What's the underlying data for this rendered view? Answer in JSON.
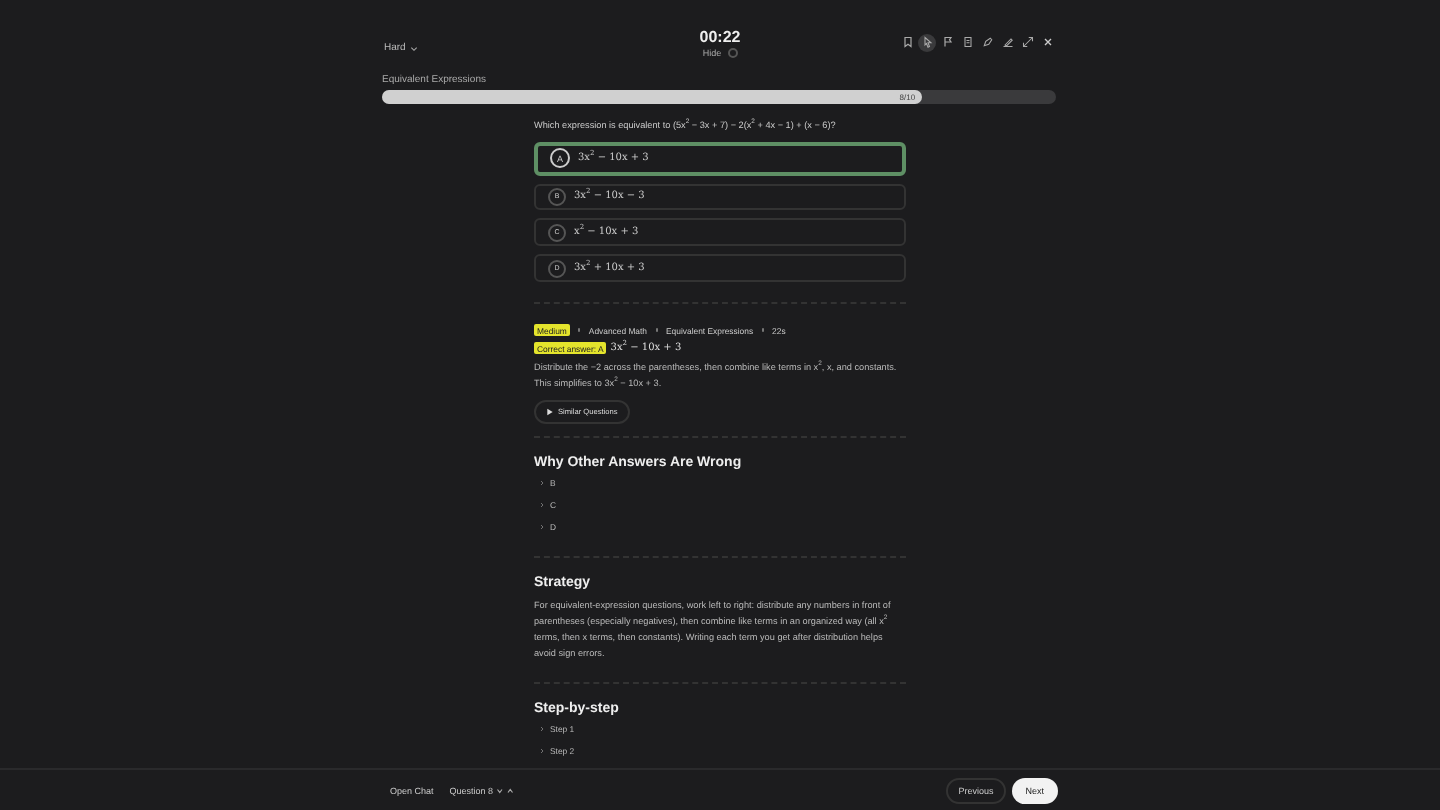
{
  "header": {
    "difficulty": "Hard",
    "timer": "00:22",
    "hide_label": "Hide",
    "hide_on": false
  },
  "toolbar": [
    {
      "kind": "bookmark",
      "selected": false
    },
    {
      "kind": "pointer",
      "selected": true
    },
    {
      "kind": "flag",
      "selected": false
    },
    {
      "kind": "note",
      "selected": false
    },
    {
      "kind": "pencil",
      "selected": false
    },
    {
      "kind": "highlight",
      "selected": false
    },
    {
      "kind": "expand",
      "selected": false
    },
    {
      "kind": "close",
      "selected": false
    }
  ],
  "progress": {
    "title": "Equivalent Expressions",
    "level": 0.8,
    "reading": "8/10"
  },
  "question": "Which expression is equivalent to (5x$^{2}$ − 3x + 7) − 2(x$^{2}$ + 4x − 1) + (x − 6)?",
  "options": [
    {
      "letter": "A",
      "text": "3x$^{2}$ − 10x + 3",
      "selected": true
    },
    {
      "letter": "B",
      "text": "3x$^{2}$ − 10x − 3",
      "selected": false
    },
    {
      "letter": "C",
      "text": "x$^{2}$ − 10x + 3",
      "selected": false
    },
    {
      "letter": "D",
      "text": "3x$^{2}$ + 10x + 3",
      "selected": false
    }
  ],
  "tags": [
    "Medium",
    "Advanced Math",
    "Equivalent Expressions",
    "22s"
  ],
  "correct_label": "Correct answer: A",
  "correct_text": "3x$^{2}$ − 10x + 3",
  "explanation": "Distribute the −2 across the parentheses, then combine like terms in x$^{2}$, x, and constants. This simplifies to 3x$^{2}$ − 10x + 3.",
  "similar_button": "Similar Questions",
  "wrong_title": "Why Other Answers Are Wrong",
  "wrong_items": [
    "B",
    "C",
    "D"
  ],
  "strategy_title": "Strategy",
  "strategy_text": "For equivalent-expression questions, work left to right: distribute any numbers in front of parentheses (especially negatives), then combine like terms in an organized way (all x$^{2}$ terms, then x terms, then constants). Writing each term you get after distribution helps avoid sign errors.",
  "steps_title": "Step-by-step",
  "steps": [
    "Step 1",
    "Step 2"
  ],
  "footer": {
    "chat": "Open Chat",
    "question": "Question 8",
    "previous": "Previous",
    "next": "Next"
  }
}
